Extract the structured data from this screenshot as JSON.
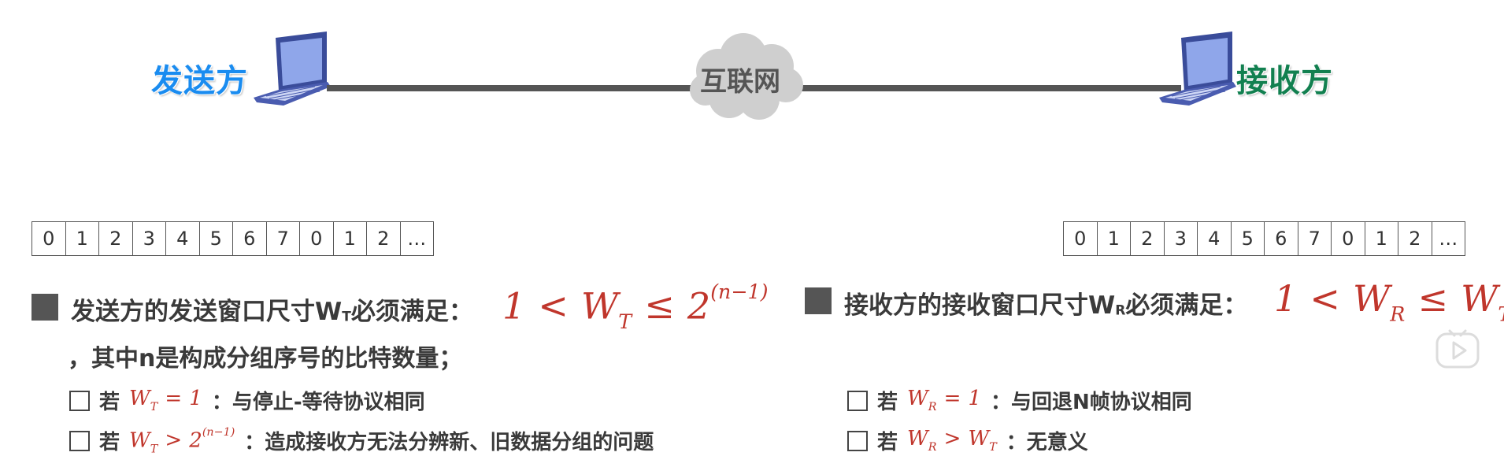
{
  "diagram": {
    "sender_label": "发送方",
    "receiver_label": "接收方",
    "network_label": "互联网",
    "colors": {
      "sender": "#1a8cf0",
      "receiver": "#128050",
      "formula": "#c0362c",
      "line": "#555555"
    }
  },
  "sender_sequence": [
    "0",
    "1",
    "2",
    "3",
    "4",
    "5",
    "6",
    "7",
    "0",
    "1",
    "2",
    "…"
  ],
  "receiver_sequence": [
    "0",
    "1",
    "2",
    "3",
    "4",
    "5",
    "6",
    "7",
    "0",
    "1",
    "2",
    "…"
  ],
  "sender_rule": {
    "heading_prefix": "发送方的发送窗口尺寸W",
    "heading_sub": "T",
    "heading_suffix": "必须满足：",
    "formula": {
      "lhs": "1",
      "op1": "<",
      "var": "W",
      "var_sub": "T",
      "op2": "≤",
      "base": "2",
      "exp": "(n−1)"
    },
    "note": "，其中n是构成分组序号的比特数量；",
    "items": [
      {
        "prefix": "若",
        "f_var": "W",
        "f_sub": "T",
        "f_op": "=",
        "f_rhs": "1",
        "text": "：与停止-等待协议相同"
      },
      {
        "prefix": "若",
        "f_var": "W",
        "f_sub": "T",
        "f_op": ">",
        "f_rhs": "2",
        "f_exp": "(n−1)",
        "text": "：造成接收方无法分辨新、旧数据分组的问题"
      }
    ]
  },
  "receiver_rule": {
    "heading_prefix": "接收方的接收窗口尺寸W",
    "heading_sub": "R",
    "heading_suffix": "必须满足：",
    "formula": {
      "lhs": "1",
      "op1": "<",
      "var": "W",
      "var_sub": "R",
      "op2": "≤",
      "rhs": "W",
      "rhs_sub": "T"
    },
    "items": [
      {
        "prefix": "若",
        "f_var": "W",
        "f_sub": "R",
        "f_op": "=",
        "f_rhs": "1",
        "text": "：与回退N帧协议相同"
      },
      {
        "prefix": "若",
        "f_var": "W",
        "f_sub": "R",
        "f_op": ">",
        "f_rhs": "W",
        "f_rhs_sub": "T",
        "text": "：无意义"
      }
    ]
  },
  "icons": [
    "laptop-icon",
    "cloud-icon",
    "play-icon"
  ]
}
